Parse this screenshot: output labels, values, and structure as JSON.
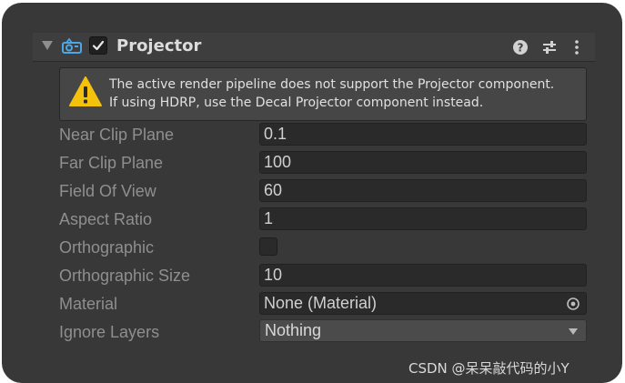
{
  "component": {
    "title": "Projector",
    "enabled": true,
    "icon": "projector-icon",
    "header_icons": [
      "help-icon",
      "presets-icon",
      "more-menu-icon"
    ]
  },
  "warning": {
    "icon": "warning-icon",
    "line1": "The active render pipeline does not support the Projector component.",
    "line2": "If using HDRP, use the Decal Projector component instead."
  },
  "properties": {
    "near_clip_plane": {
      "label": "Near Clip Plane",
      "value": "0.1"
    },
    "far_clip_plane": {
      "label": "Far Clip Plane",
      "value": "100"
    },
    "field_of_view": {
      "label": "Field Of View",
      "value": "60"
    },
    "aspect_ratio": {
      "label": "Aspect Ratio",
      "value": "1"
    },
    "orthographic": {
      "label": "Orthographic",
      "checked": false
    },
    "orthographic_size": {
      "label": "Orthographic Size",
      "value": "10"
    },
    "material": {
      "label": "Material",
      "value": "None (Material)"
    },
    "ignore_layers": {
      "label": "Ignore Layers",
      "value": "Nothing"
    }
  },
  "watermark": "CSDN @呆呆敲代码的小Y",
  "colors": {
    "panel_bg": "#383838",
    "field_bg": "#2a2a2a",
    "label": "#8f8f8f",
    "warning_yellow": "#f4c20d",
    "projector_icon": "#4aa8e8"
  }
}
